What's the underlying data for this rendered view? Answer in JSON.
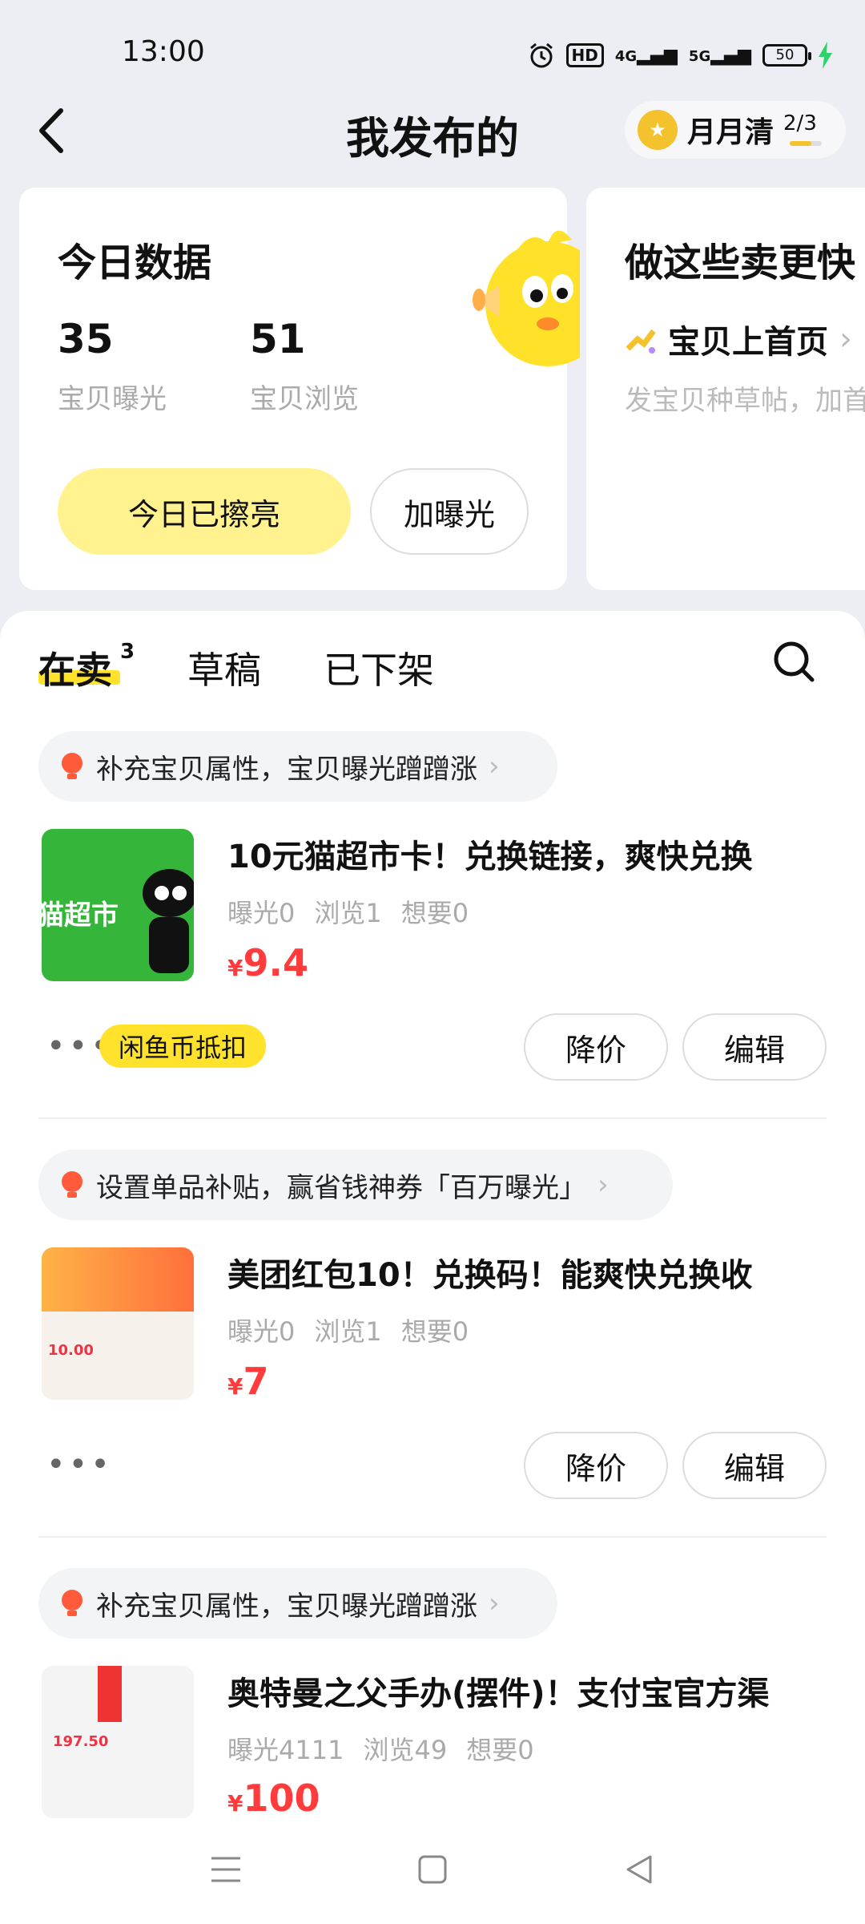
{
  "status": {
    "time": "13:00",
    "hd": "HD",
    "net1": "4G",
    "net2": "5G",
    "battery": "50"
  },
  "header": {
    "title": "我发布的",
    "monthly_label": "月月清",
    "monthly_progress": "2/3",
    "monthly_fraction": 0.667
  },
  "today": {
    "title": "今日数据",
    "exposure_value": "35",
    "exposure_label": "宝贝曝光",
    "views_value": "51",
    "views_label": "宝贝浏览",
    "polished_button": "今日已擦亮",
    "boost_button": "加曝光"
  },
  "tips_card": {
    "title": "做这些卖更快",
    "item": "宝贝上首页",
    "sub": "发宝贝种草帖，加首"
  },
  "tabs": [
    {
      "label": "在卖",
      "count": "3"
    },
    {
      "label": "草稿"
    },
    {
      "label": "已下架"
    }
  ],
  "items": [
    {
      "tip": "补充宝贝属性，宝贝曝光蹭蹭涨",
      "title": "10元猫超市卡！兑换链接，爽快兑换",
      "stats": [
        "曝光0",
        "浏览1",
        "想要0"
      ],
      "currency": "¥",
      "price": "9.4",
      "tag": "闲鱼币抵扣",
      "thumb_text": "猫超市",
      "buttons": [
        "降价",
        "编辑"
      ]
    },
    {
      "tip": "设置单品补贴，赢省钱神券「百万曝光」",
      "title": "美团红包10！兑换码！能爽快兑换收",
      "stats": [
        "曝光0",
        "浏览1",
        "想要0"
      ],
      "currency": "¥",
      "price": "7",
      "thumb_text": "10.00",
      "buttons": [
        "降价",
        "编辑"
      ]
    },
    {
      "tip": "补充宝贝属性，宝贝曝光蹭蹭涨",
      "title": "奥特曼之父手办(摆件)！支付宝官方渠",
      "stats": [
        "曝光4111",
        "浏览49",
        "想要0"
      ],
      "currency": "¥",
      "price": "100",
      "thumb_text": "197.50"
    }
  ],
  "colors": {
    "accent_yellow": "#ffe22c",
    "price_red": "#ff3b3b",
    "background": "#eceef4"
  }
}
